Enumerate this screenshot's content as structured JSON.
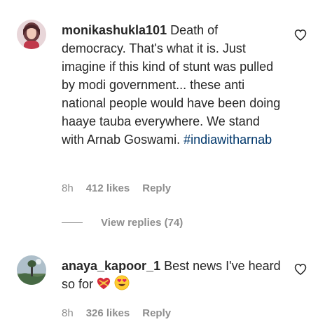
{
  "comments": [
    {
      "username": "monikashukla101",
      "text": "Death of democracy. That's what it is. Just imagine if this kind of stunt was pulled by modi government... these anti national people would have been doing haaye tauba everywhere. We stand with Arnab Goswami.",
      "hashtag": "#indiawitharnab",
      "time": "8h",
      "likes": "412 likes",
      "reply_label": "Reply",
      "avatar_icon": "user-avatar-woman"
    },
    {
      "username": "anaya_kapoor_1",
      "text": "Best news I've heard so for",
      "emojis": [
        "heart-with-ribbon",
        "heart-eyes"
      ],
      "time": "8h",
      "likes": "326 likes",
      "reply_label": "Reply",
      "avatar_icon": "user-avatar-landscape"
    }
  ],
  "view_replies": "View replies (74)",
  "icons": {
    "like": "heart-outline-icon"
  },
  "colors": {
    "text": "#262626",
    "secondary": "#8e8e8e",
    "hashtag": "#00376b"
  }
}
